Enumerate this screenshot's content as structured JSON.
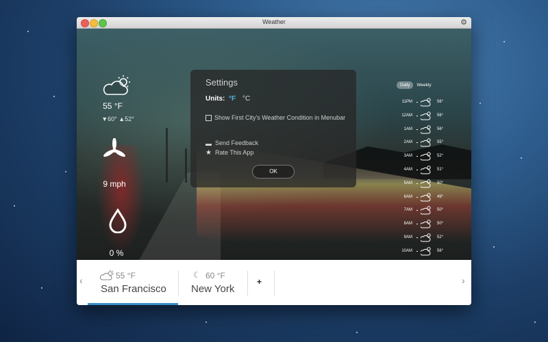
{
  "window": {
    "title": "Weather"
  },
  "current": {
    "temp": "55 °F",
    "hilo": "▼60° ▲52°",
    "wind": "9 mph",
    "humidity": "0 %"
  },
  "forecast_toggle": {
    "daily": "Daily",
    "weekly": "Weekly"
  },
  "hourly": [
    {
      "time": "11PM",
      "temp": "56°"
    },
    {
      "time": "12AM",
      "temp": "56°"
    },
    {
      "time": "1AM",
      "temp": "56°"
    },
    {
      "time": "2AM",
      "temp": "55°"
    },
    {
      "time": "3AM",
      "temp": "52°"
    },
    {
      "time": "4AM",
      "temp": "51°"
    },
    {
      "time": "5AM",
      "temp": "50°"
    },
    {
      "time": "6AM",
      "temp": "49°"
    },
    {
      "time": "7AM",
      "temp": "50°"
    },
    {
      "time": "8AM",
      "temp": "50°"
    },
    {
      "time": "9AM",
      "temp": "52°"
    },
    {
      "time": "10AM",
      "temp": "56°"
    }
  ],
  "settings": {
    "title": "Settings",
    "units_label": "Units:",
    "unit_f": "°F",
    "unit_c": "°C",
    "menubar_option": "Show First City's Weather Condition in Menubar",
    "feedback": "Send Feedback",
    "rate": "Rate This App",
    "ok": "OK"
  },
  "cities": [
    {
      "name": "San Francisco",
      "temp": "55 °F",
      "icon": "partly-cloudy-icon"
    },
    {
      "name": "New York",
      "temp": "60 °F",
      "icon": "moon-icon"
    }
  ],
  "add_city": "+",
  "colors": {
    "accent": "#3b8fc9",
    "unit_active": "#4fb5e6"
  }
}
